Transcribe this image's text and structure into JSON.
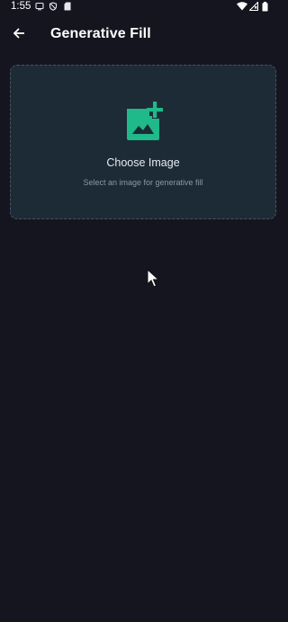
{
  "status_bar": {
    "time": "1:55",
    "icons": [
      "screen-record-icon",
      "do-not-disturb-icon",
      "sd-card-icon",
      "wifi-icon",
      "signal-icon",
      "battery-icon"
    ]
  },
  "app_bar": {
    "back_icon": "arrow-back-icon",
    "title": "Generative Fill"
  },
  "upload_card": {
    "icon": "add-photo-icon",
    "title": "Choose Image",
    "subtitle": "Select an image for generative fill"
  },
  "colors": {
    "background": "#14151f",
    "card_background": "#1d2b36",
    "card_border": "#4a5360",
    "accent": "#1fb98a",
    "title_text": "#ffffff",
    "subtitle_text": "#8d97a3"
  }
}
